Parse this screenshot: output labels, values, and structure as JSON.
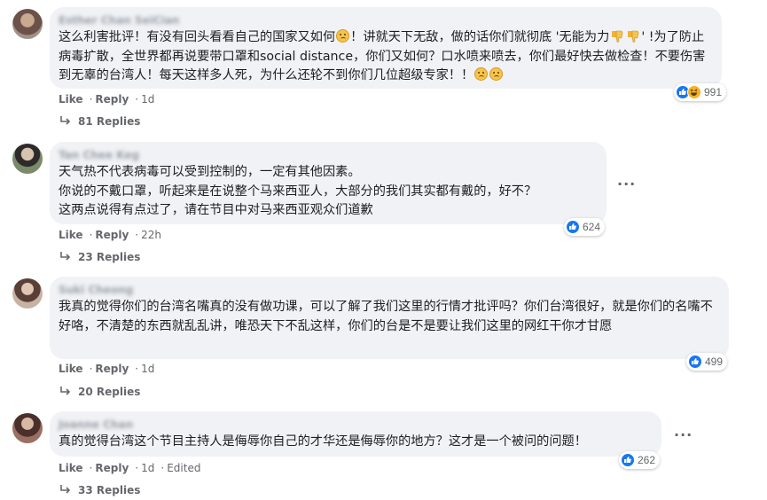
{
  "comments": [
    {
      "author": "Esther Chan SeiCian",
      "text_parts": [
        "这么利害批评！有没有回头看看自己的国家又如何",
        "！讲就天下无敌，做的话你们就彻底 '无能为力",
        "' !为了防止病毒扩散，全世界都再说要带口罩和social distance，你们又如何？口水喷来喷去，你们最好快去做检查！不要伤害到无辜的台湾人！每天这样多人死，为什么还轮不到你们几位超级专家！！"
      ],
      "like": "Like",
      "reply": "Reply",
      "time": "1d",
      "reaction_count": "991",
      "replies": "81 Replies"
    },
    {
      "author": "Tan Chee Keg",
      "text": "天气热不代表病毒可以受到控制的，一定有其他因素。\n你说的不戴口罩，听起来是在说整个马来西亚人，大部分的我们其实都有戴的，好不？\n这两点说得有点过了，请在节目中对马来西亚观众们道歉",
      "like": "Like",
      "reply": "Reply",
      "time": "22h",
      "reaction_count": "624",
      "replies": "23 Replies"
    },
    {
      "author": "Suki Cheong",
      "text": "我真的觉得你们的台湾名嘴真的没有做功课，可以了解了我们这里的行情才批评吗？你们台湾很好，就是你们的名嘴不好咯，不清楚的东西就乱乱讲，唯恐天下不乱这样，你们的台是不是要让我们这里的网红干你才甘愿",
      "like": "Like",
      "reply": "Reply",
      "time": "1d",
      "reaction_count": "499",
      "replies": "20 Replies"
    },
    {
      "author": "Joanne Chan",
      "text": "真的觉得台湾这个节目主持人是侮辱你自己的才华还是侮辱你的地方？这才是一个被问的问题！",
      "like": "Like",
      "reply": "Reply",
      "time": "1d",
      "edited": "Edited",
      "reaction_count": "262",
      "replies": "33 Replies"
    }
  ],
  "icons": {
    "more": "more-options-icon",
    "like_reaction": "like-reaction-icon",
    "haha_reaction": "haha-reaction-icon",
    "reply_arrow": "reply-arrow-icon",
    "angry_emoji": "frowning-face-emoji",
    "thumbs_down_emoji": "thumbs-down-emoji"
  },
  "colors": {
    "bubble": "#f0f2f5",
    "like_blue": "#1877f2",
    "meta_gray": "#65676b"
  }
}
